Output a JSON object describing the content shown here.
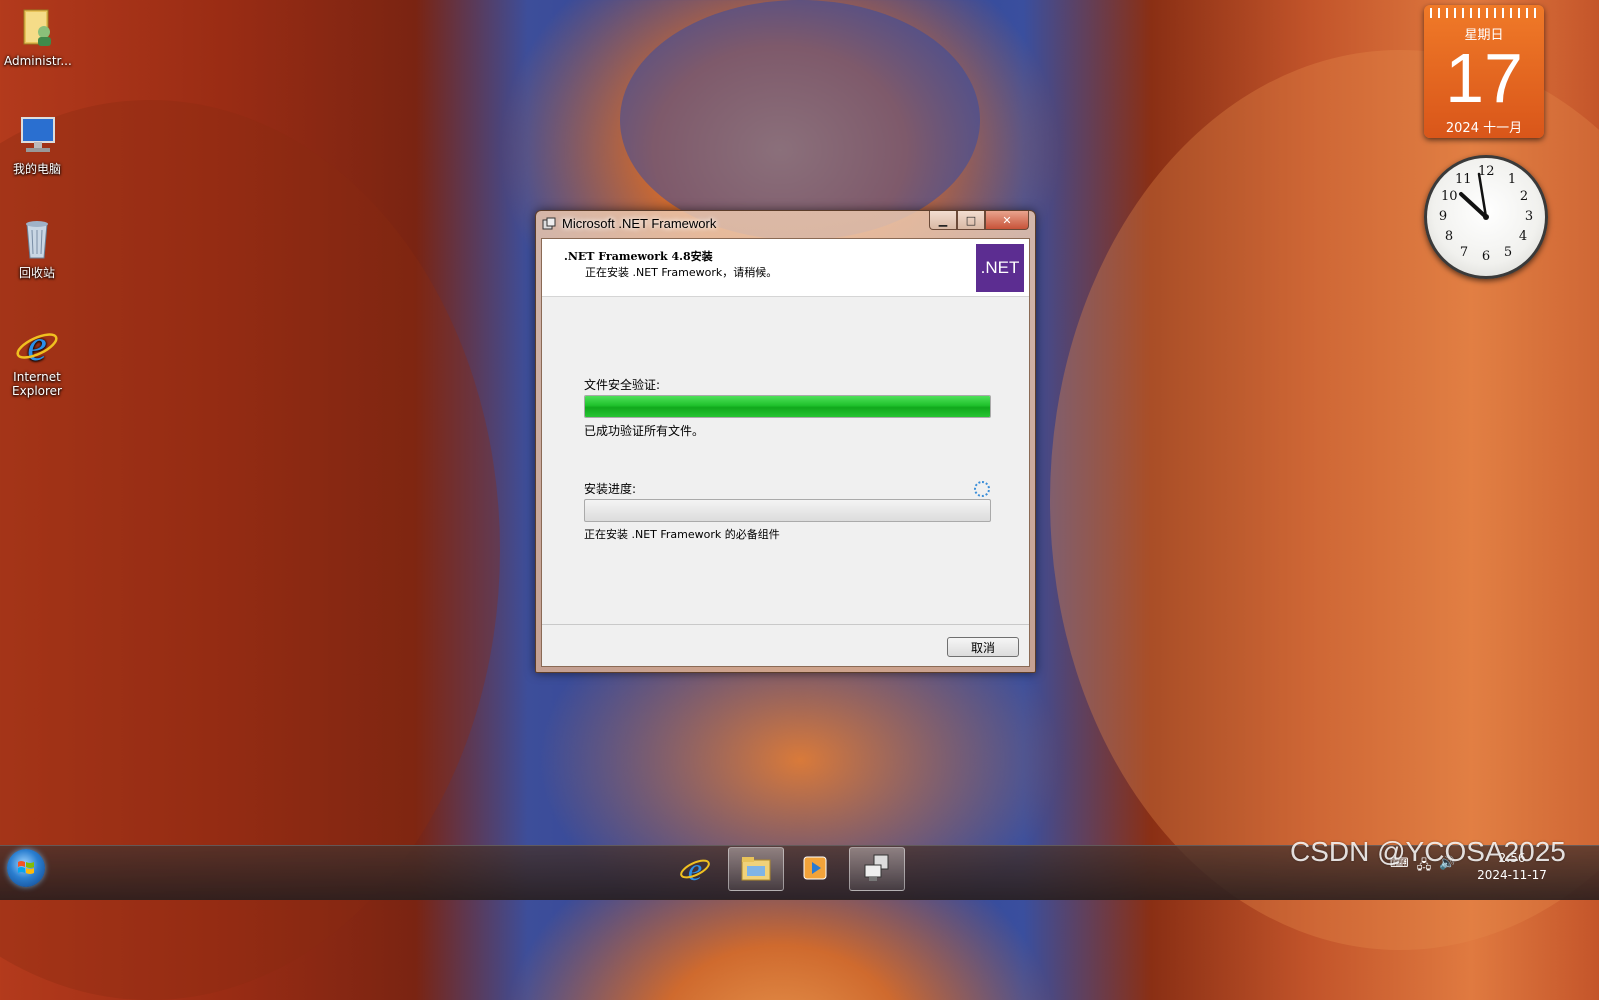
{
  "desktop": {
    "icons": [
      {
        "label": "Administr..."
      },
      {
        "label": "我的电脑"
      },
      {
        "label": "回收站"
      },
      {
        "label": "Internet Explorer"
      }
    ]
  },
  "calendar_gadget": {
    "weekday": "星期日",
    "day": "17",
    "year_month": "2024 十一月"
  },
  "clock_gadget": {
    "numerals": [
      "12",
      "1",
      "2",
      "3",
      "4",
      "5",
      "6",
      "7",
      "8",
      "9",
      "10",
      "11"
    ]
  },
  "dialog": {
    "title": "Microsoft .NET Framework",
    "header_title": ".NET Framework 4.8安装",
    "header_subtitle": "正在安装 .NET Framework，请稍候。",
    "logo_text": ".NET",
    "verify_label": "文件安全验证:",
    "verify_progress": 1.0,
    "verify_status": "已成功验证所有文件。",
    "install_label": "安装进度:",
    "install_progress": 0.0,
    "install_status": "正在安装 .NET Framework 的必备组件",
    "cancel_label": "取消"
  },
  "taskbar": {
    "pinned": [
      "ie-icon",
      "explorer-icon",
      "media-player-icon",
      "network-app-icon"
    ],
    "time": "2:56",
    "date": "2024-11-17"
  },
  "watermark": "CSDN @YCOSA2025"
}
